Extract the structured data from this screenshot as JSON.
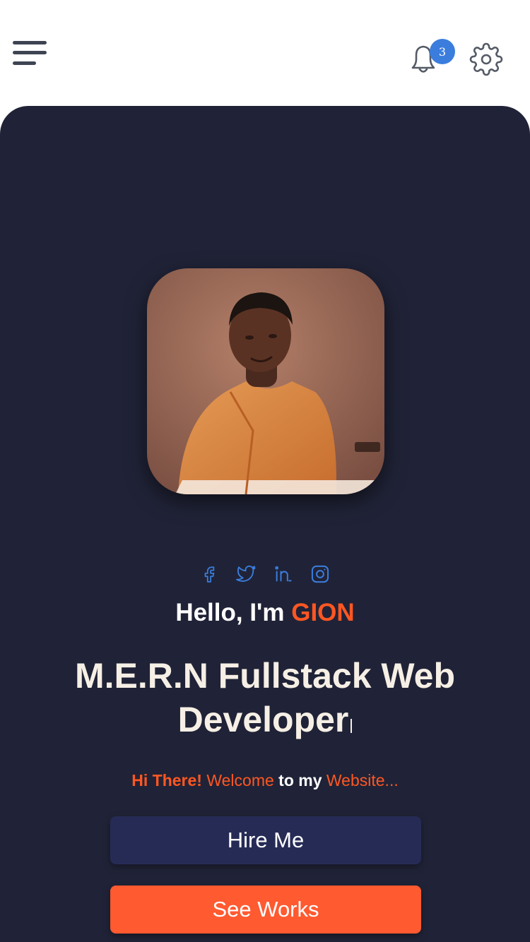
{
  "header": {
    "notification_count": "3"
  },
  "social_links": [
    {
      "icon": "facebook-icon"
    },
    {
      "icon": "twitter-icon"
    },
    {
      "icon": "linkedin-icon"
    },
    {
      "icon": "instagram-icon"
    }
  ],
  "hero": {
    "greeting_prefix": "Hello, I'm",
    "name": "GION",
    "role": "M.E.R.N Fullstack Web Developer",
    "tagline": {
      "hi": "Hi There!",
      "welcome": "Welcome",
      "to_my": "to my",
      "website": "Website..."
    },
    "hire_button": "Hire Me",
    "works_button": "See Works"
  },
  "colors": {
    "accent": "#ff5722",
    "hero_bg": "#202337",
    "primary_button": "#262b56",
    "social_icon": "#3b7ddd",
    "badge": "#3b7ddd"
  }
}
